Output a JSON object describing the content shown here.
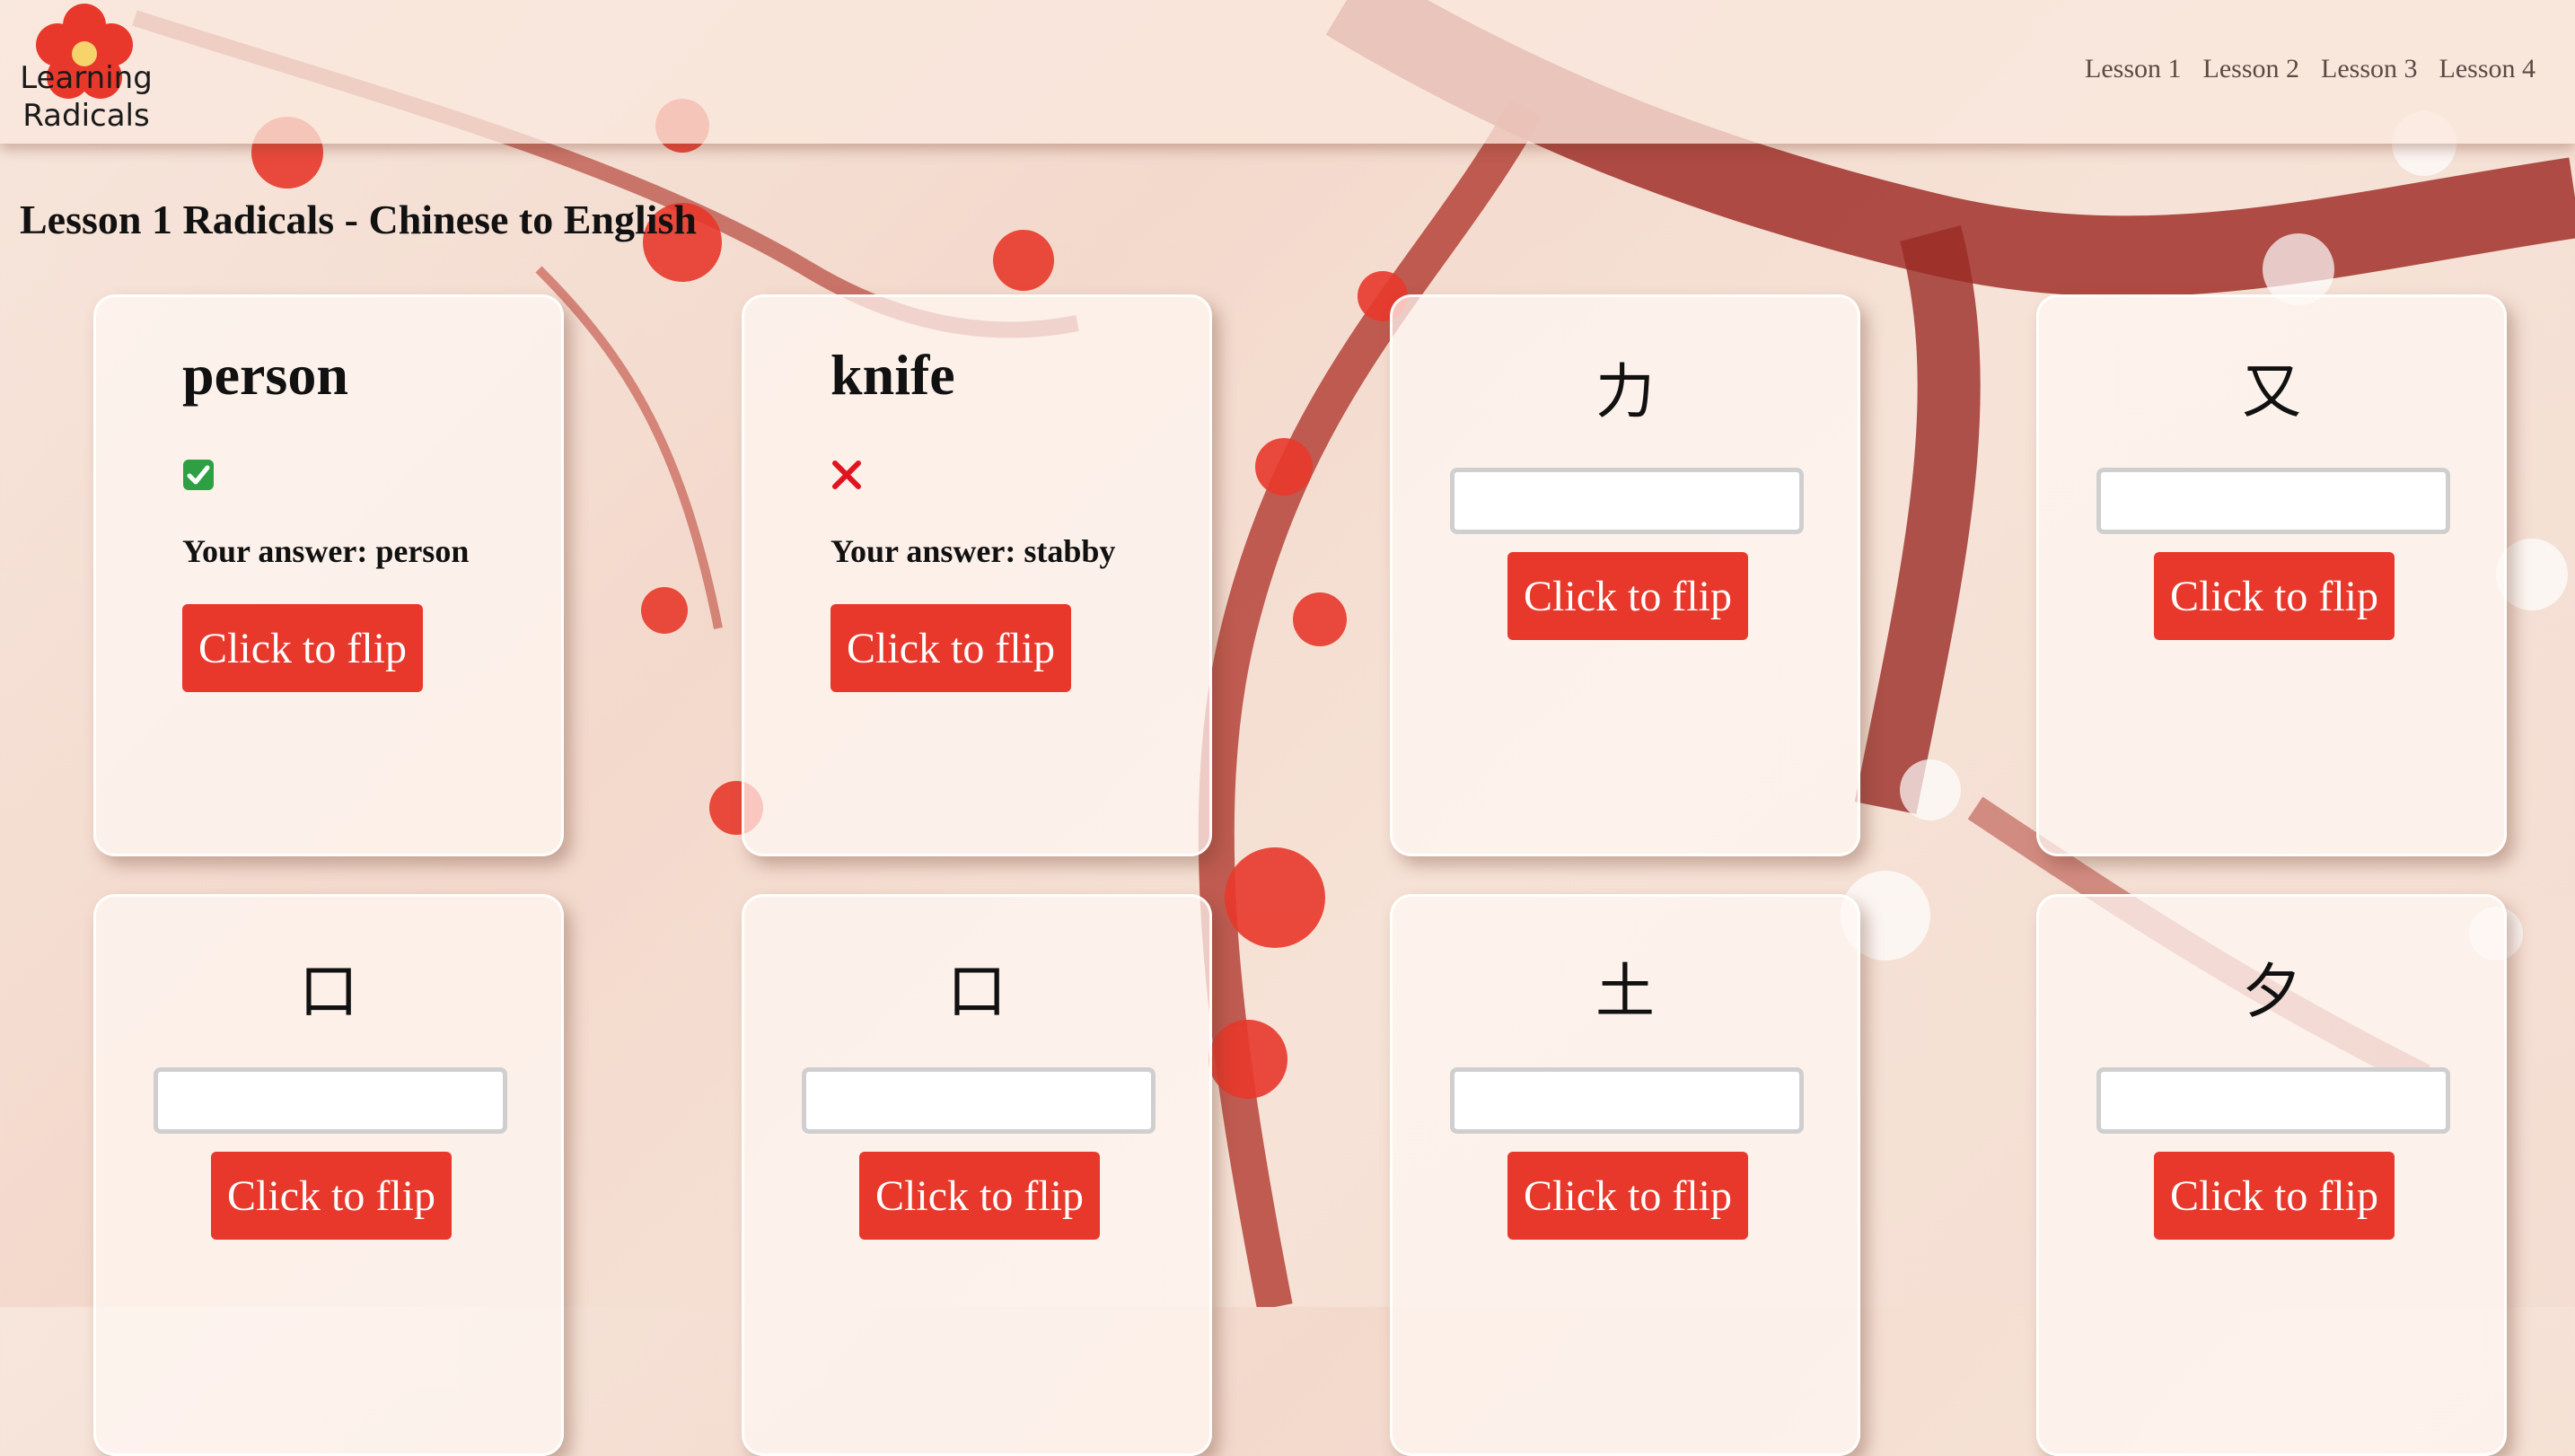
{
  "app": {
    "logo_line1": "Learning",
    "logo_line2": "Radicals"
  },
  "nav": [
    "Lesson 1",
    "Lesson 2",
    "Lesson 3",
    "Lesson 4"
  ],
  "page_title": "Lesson 1 Radicals - Chinese to English",
  "colors": {
    "accent": "#e8382b",
    "correct": "#2ea043",
    "wrong": "#e0141e"
  },
  "cards": [
    {
      "state": "flipped",
      "word": "person",
      "result": "correct",
      "answer": "Your answer: person",
      "button": "Click to flip"
    },
    {
      "state": "flipped",
      "word": "knife",
      "result": "wrong",
      "answer": "Your answer: stabby",
      "button": "Click to flip"
    },
    {
      "state": "front",
      "radical": "力",
      "button": "Click to flip"
    },
    {
      "state": "front",
      "radical": "又",
      "button": "Click to flip"
    },
    {
      "state": "front",
      "radical": "口",
      "button": "Click to flip"
    },
    {
      "state": "front",
      "radical": "口",
      "button": "Click to flip"
    },
    {
      "state": "front",
      "radical": "土",
      "button": "Click to flip"
    },
    {
      "state": "front",
      "radical": "夕",
      "button": "Click to flip"
    }
  ]
}
